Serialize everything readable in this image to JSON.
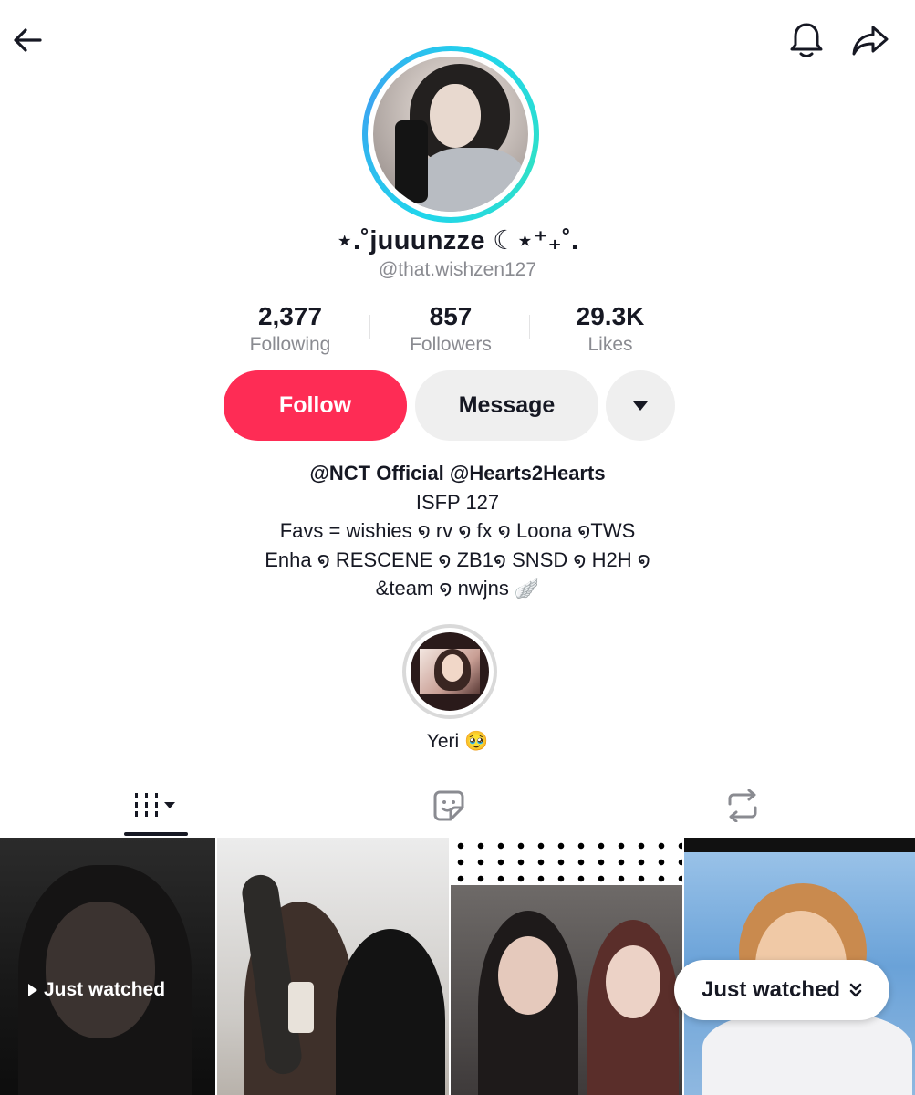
{
  "header": {
    "back_icon": "arrow-left-icon",
    "notification_icon": "bell-icon",
    "share_icon": "share-arrow-icon"
  },
  "profile": {
    "display_name": "⋆.˚juuunzze ☾⋆⁺₊˚.",
    "username": "@that.wishzen127"
  },
  "stats": {
    "following": {
      "value": "2,377",
      "label": "Following"
    },
    "followers": {
      "value": "857",
      "label": "Followers"
    },
    "likes": {
      "value": "29.3K",
      "label": "Likes"
    }
  },
  "actions": {
    "follow_label": "Follow",
    "message_label": "Message",
    "more_icon": "caret-down-icon"
  },
  "bio": {
    "mentions": "@NCT Official @Hearts2Hearts",
    "lines": [
      "ISFP 127",
      "Favs =  wishies ໑ rv ໑ fx ໑ Loona ໑TWS",
      "Enha ໑ RESCENE ໑ ZB1໑ SNSD ໑ H2H ໑",
      "&team ໑ nwjns  🪽"
    ]
  },
  "highlight": {
    "label": "Yeri 🥹"
  },
  "tabs": [
    {
      "name": "videos",
      "icon": "grid-bars-icon",
      "active": true
    },
    {
      "name": "liked",
      "icon": "sticker-icon",
      "active": false
    },
    {
      "name": "reposts",
      "icon": "repost-icon",
      "active": false
    }
  ],
  "grid": {
    "overlay_text": "Just watched",
    "pill_text": "Just watched"
  },
  "colors": {
    "follow": "#fe2c55",
    "ring_accent": "#20d5ec",
    "secondary_text": "#8a8b91"
  }
}
